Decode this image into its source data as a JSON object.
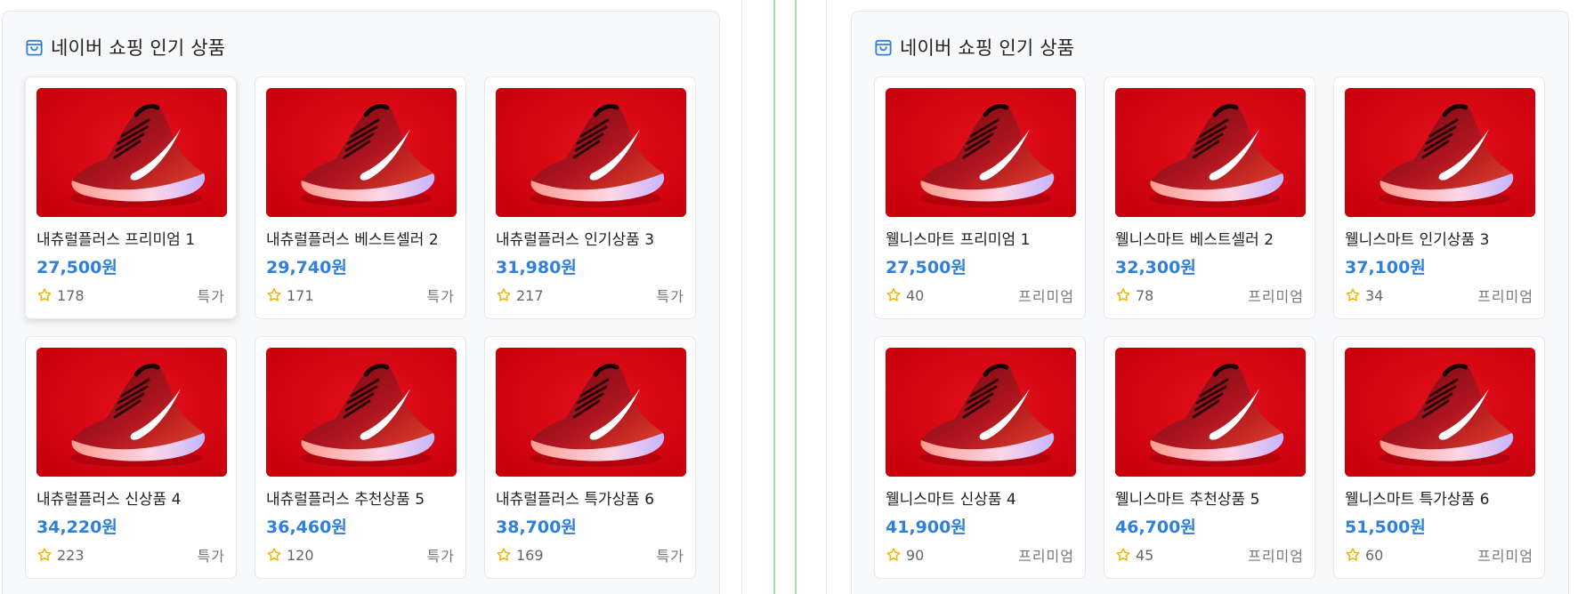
{
  "colors": {
    "accent_price": "#2f7fdc",
    "star": "#f0b400",
    "image_background": "#d4000f",
    "divider_green": "#a8d9b3"
  },
  "panels": [
    {
      "title": "네이버 쇼핑 인기 상품",
      "icon": "shopping-bag-icon",
      "products": [
        {
          "name": "내츄럴플러스 프리미엄 1",
          "price": "27,500원",
          "rating_count": "178",
          "tag": "특가"
        },
        {
          "name": "내츄럴플러스 베스트셀러 2",
          "price": "29,740원",
          "rating_count": "171",
          "tag": "특가"
        },
        {
          "name": "내츄럴플러스 인기상품 3",
          "price": "31,980원",
          "rating_count": "217",
          "tag": "특가"
        },
        {
          "name": "내츄럴플러스 신상품 4",
          "price": "34,220원",
          "rating_count": "223",
          "tag": "특가"
        },
        {
          "name": "내츄럴플러스 추천상품 5",
          "price": "36,460원",
          "rating_count": "120",
          "tag": "특가"
        },
        {
          "name": "내츄럴플러스 특가상품 6",
          "price": "38,700원",
          "rating_count": "169",
          "tag": "특가"
        }
      ]
    },
    {
      "title": "네이버 쇼핑 인기 상품",
      "icon": "shopping-bag-icon",
      "products": [
        {
          "name": "웰니스마트 프리미엄 1",
          "price": "27,500원",
          "rating_count": "40",
          "tag": "프리미엄"
        },
        {
          "name": "웰니스마트 베스트셀러 2",
          "price": "32,300원",
          "rating_count": "78",
          "tag": "프리미엄"
        },
        {
          "name": "웰니스마트 인기상품 3",
          "price": "37,100원",
          "rating_count": "34",
          "tag": "프리미엄"
        },
        {
          "name": "웰니스마트 신상품 4",
          "price": "41,900원",
          "rating_count": "90",
          "tag": "프리미엄"
        },
        {
          "name": "웰니스마트 추천상품 5",
          "price": "46,700원",
          "rating_count": "45",
          "tag": "프리미엄"
        },
        {
          "name": "웰니스마트 특가상품 6",
          "price": "51,500원",
          "rating_count": "60",
          "tag": "프리미엄"
        }
      ]
    }
  ]
}
